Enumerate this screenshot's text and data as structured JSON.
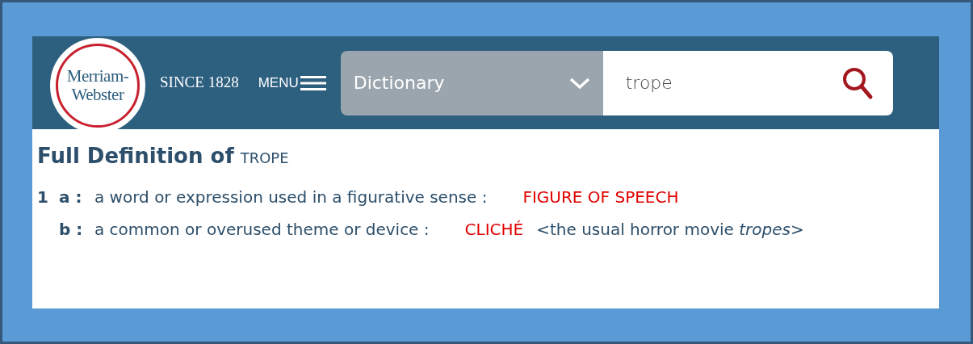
{
  "logo": {
    "line_1": "Merriam-",
    "line_2": "Webster"
  },
  "tagline": "SINCE 1828",
  "menu": {
    "label": "MENU"
  },
  "search": {
    "scope": "Dictionary",
    "value": "trope"
  },
  "heading": {
    "title": "Full Definition of",
    "word": "TROPE"
  },
  "senses": [
    {
      "number": "1",
      "letter": "a :",
      "text": "a word or expression used in a figurative sense :",
      "crossref": "FIGURE OF SPEECH"
    },
    {
      "letter": "b :",
      "text": "a common or overused theme or device :",
      "crossref": "CLICHÉ",
      "example": "<the usual horror movie *tropes*>"
    }
  ]
}
